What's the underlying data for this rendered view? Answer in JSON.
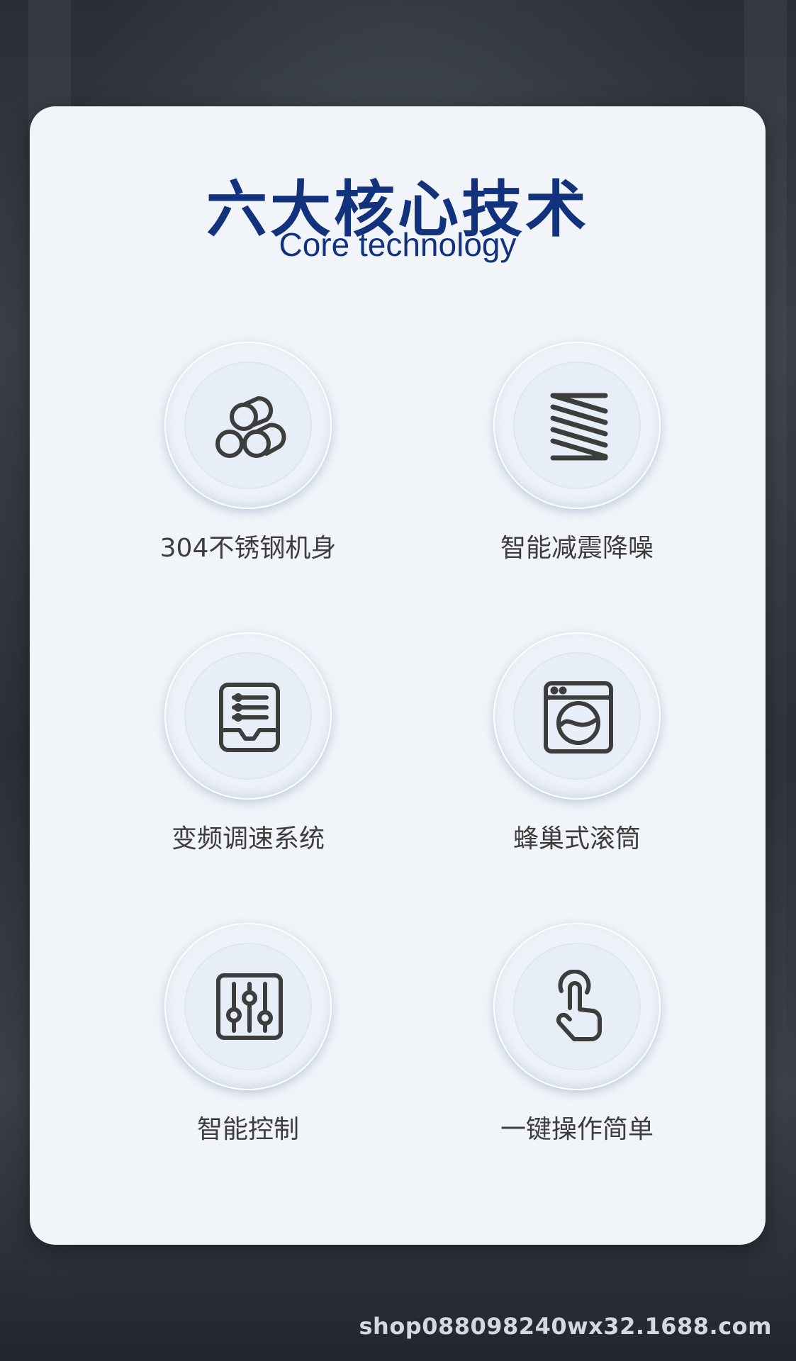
{
  "header": {
    "title": "六大核心技术",
    "subtitle": "Core technology"
  },
  "features": [
    {
      "label": "304不锈钢机身",
      "icon": "steel-pipes-icon"
    },
    {
      "label": "智能减震降噪",
      "icon": "spring-icon"
    },
    {
      "label": "变频调速系统",
      "icon": "control-panel-icon"
    },
    {
      "label": "蜂巢式滚筒",
      "icon": "washing-machine-icon"
    },
    {
      "label": "智能控制",
      "icon": "sliders-icon"
    },
    {
      "label": "一键操作简单",
      "icon": "touch-hand-icon"
    }
  ],
  "watermark": "shop088098240wx32.1688.com",
  "colors": {
    "title": "#12327e",
    "card_background": "#f1f5fa",
    "icon_stroke": "#3d3d3d",
    "label_text": "#3d3d3d"
  }
}
